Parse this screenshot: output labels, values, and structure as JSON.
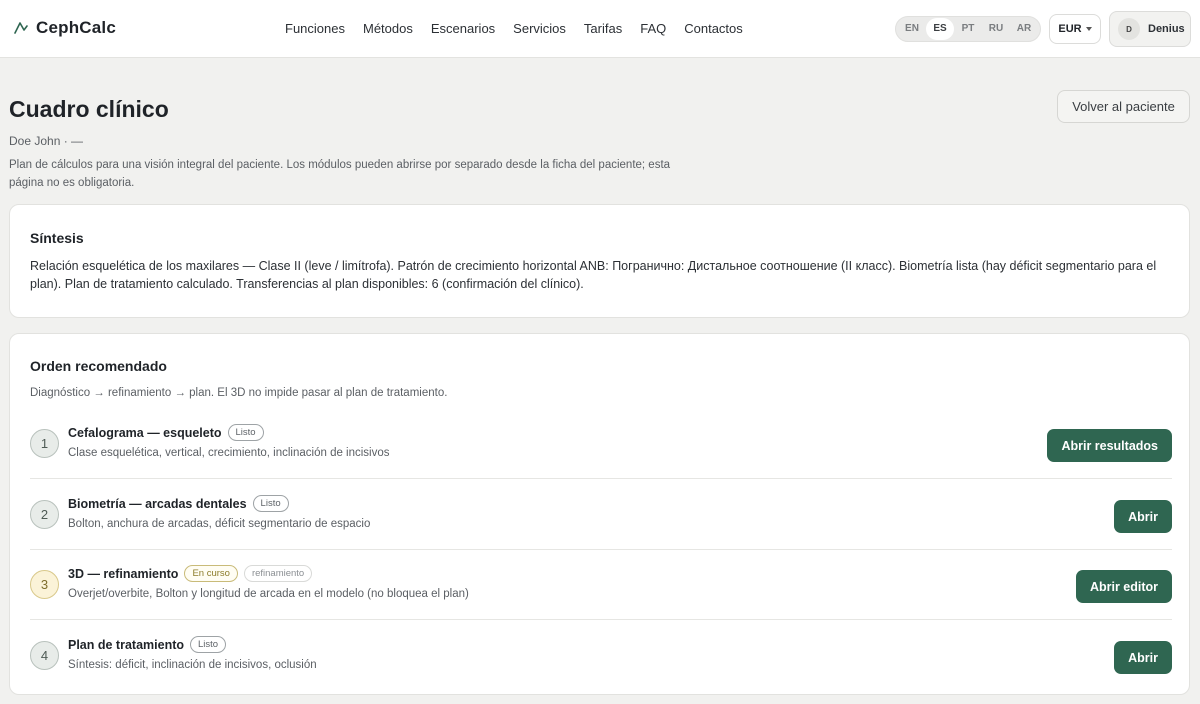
{
  "header": {
    "brand": "CephCalc",
    "nav": [
      "Funciones",
      "Métodos",
      "Escenarios",
      "Servicios",
      "Tarifas",
      "FAQ",
      "Contactos"
    ],
    "languages": [
      "EN",
      "ES",
      "PT",
      "RU",
      "AR"
    ],
    "active_language": "ES",
    "currency": "EUR",
    "user_initial": "D",
    "user_name": "Denius"
  },
  "page": {
    "title": "Cuadro clínico",
    "back_button": "Volver al paciente",
    "patient": "Doe John · —",
    "description": "Plan de cálculos para una visión integral del paciente. Los módulos pueden abrirse por separado desde la ficha del paciente; esta página no es obligatoria."
  },
  "synthesis": {
    "title": "Síntesis",
    "text": "Relación esquelética de los maxilares — Clase II (leve / limítrofa). Patrón de crecimiento horizontal ANB: Погранично: Дистальное соотношение (II класс). Biometría lista (hay déficit segmentario para el plan). Plan de tratamiento calculado. Transferencias al plan disponibles: 6 (confirmación del clínico)."
  },
  "order": {
    "title": "Orden recomendado",
    "subtitle": "Diagnóstico → refinamiento → plan. El 3D no impide pasar al plan de tratamiento.",
    "steps": [
      {
        "num": "1",
        "title": "Cefalograma — esqueleto",
        "tag": "Listo",
        "tag2": "",
        "desc": "Clase esquelética, vertical, crecimiento, inclinación de incisivos",
        "action": "Abrir resultados"
      },
      {
        "num": "2",
        "title": "Biometría — arcadas dentales",
        "tag": "Listo",
        "tag2": "",
        "desc": "Bolton, anchura de arcadas, déficit segmentario de espacio",
        "action": "Abrir"
      },
      {
        "num": "3",
        "title": "3D — refinamiento",
        "tag": "En curso",
        "tag2": "refinamiento",
        "desc": "Overjet/overbite, Bolton y longitud de arcada en el modelo (no bloquea el plan)",
        "action": "Abrir editor"
      },
      {
        "num": "4",
        "title": "Plan de tratamiento",
        "tag": "Listo",
        "tag2": "",
        "desc": "Síntesis: déficit, inclinación de incisivos, oclusión",
        "action": "Abrir"
      }
    ]
  },
  "colors": {
    "primary": "#2f6651",
    "background": "#f1f1ef",
    "warning": "#fbf3d8"
  }
}
